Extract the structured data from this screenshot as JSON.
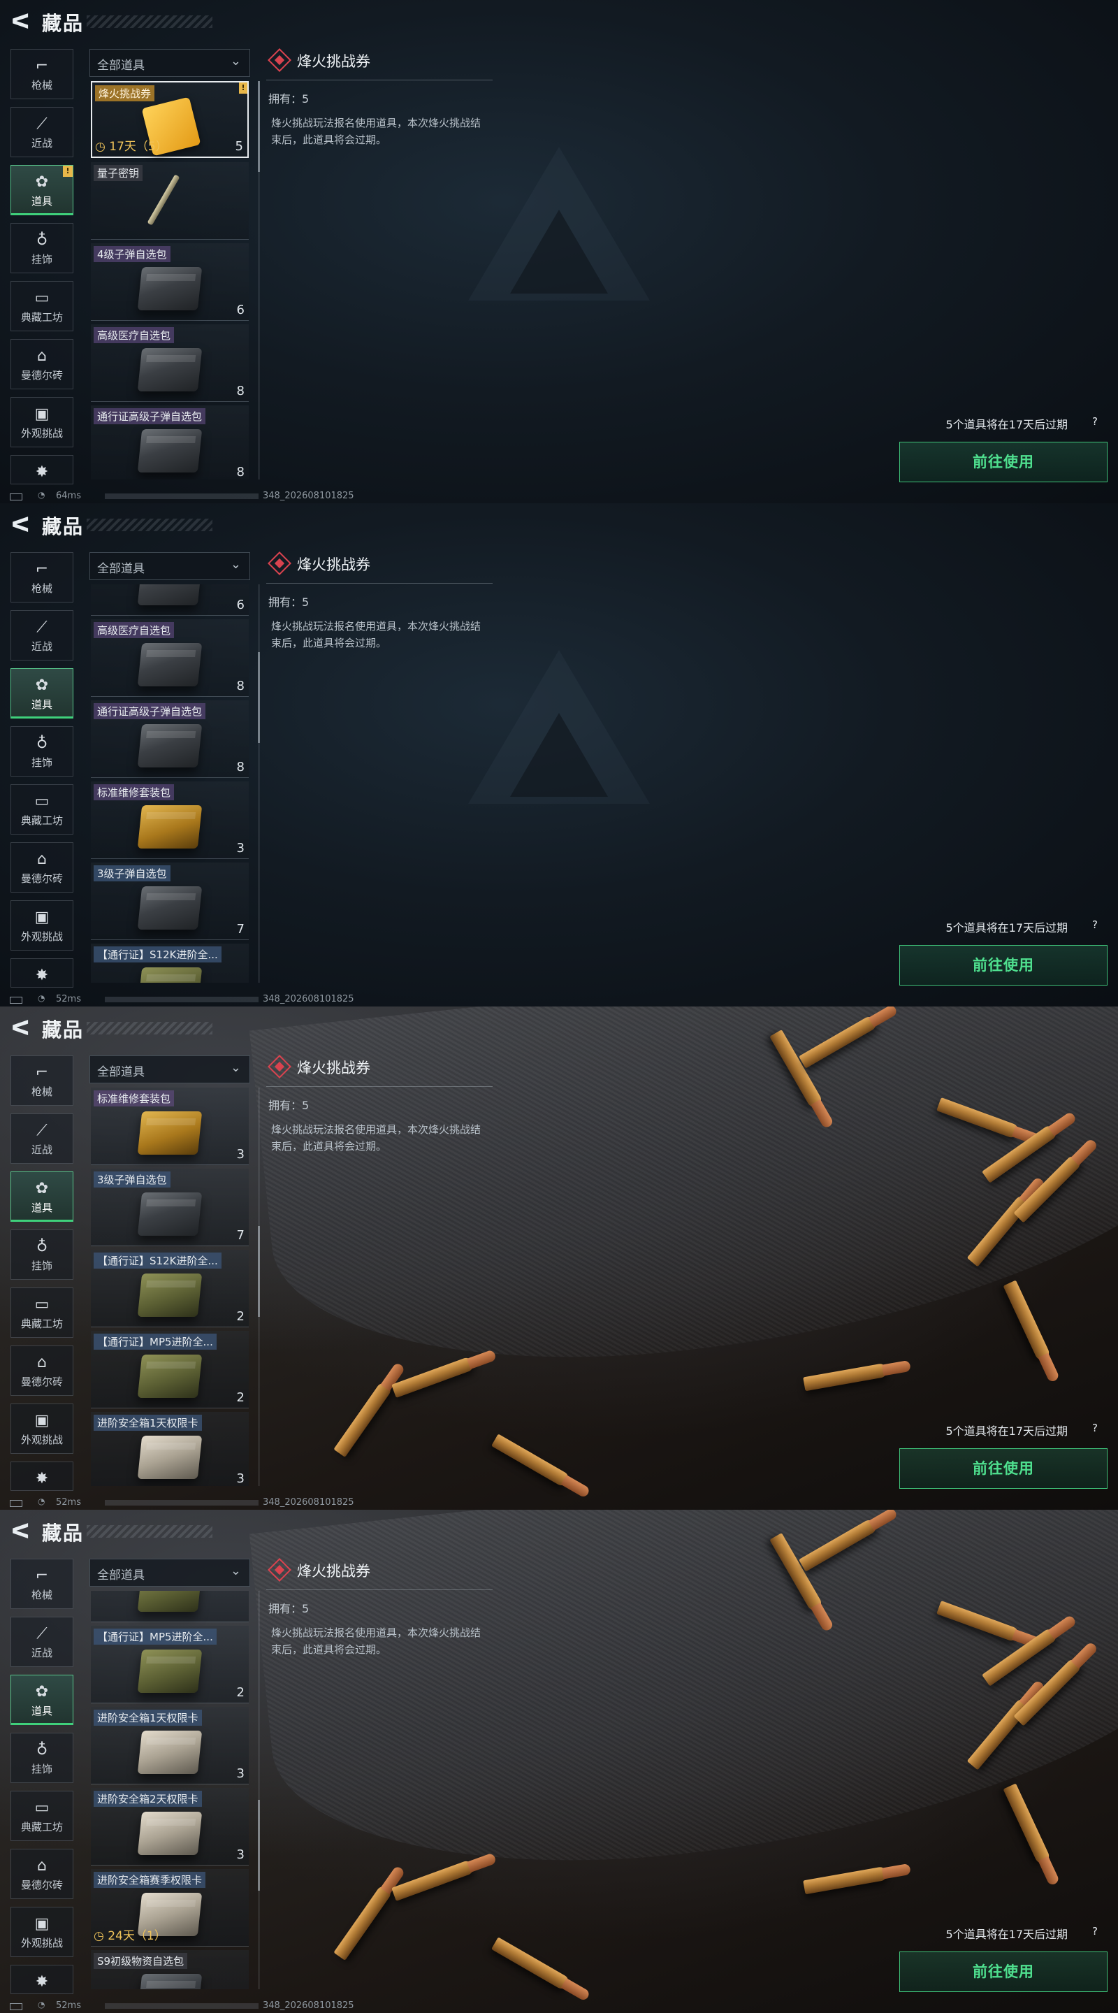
{
  "header": {
    "back_icon": "back-arrow-icon",
    "title": "藏品"
  },
  "categories": [
    {
      "icon": "gun-icon",
      "glyph": "⌐",
      "label": "枪械"
    },
    {
      "icon": "knife-icon",
      "glyph": "⟋",
      "label": "近战"
    },
    {
      "icon": "props-icon",
      "glyph": "✿",
      "label": "道具"
    },
    {
      "icon": "pendant-icon",
      "glyph": "♁",
      "label": "挂饰"
    },
    {
      "icon": "workshop-icon",
      "glyph": "▭",
      "label": "典藏工坊"
    },
    {
      "icon": "brick-icon",
      "glyph": "⌂",
      "label": "曼德尔砖"
    },
    {
      "icon": "appearance-icon",
      "glyph": "▣",
      "label": "外观挑战"
    },
    {
      "icon": "partial-icon",
      "glyph": "✸",
      "label": ""
    }
  ],
  "filter": {
    "value": "全部道具",
    "chevron": "chevron-down-icon"
  },
  "detail": {
    "title": "烽火挑战券",
    "owned": "拥有：5",
    "description": "烽火挑战玩法报名使用道具，本次烽火挑战结束后，此道具将会过期。",
    "expire_note": "5个道具将在17天后过期",
    "help": "?",
    "use_button": "前往使用"
  },
  "status": {
    "ping_a": "64ms",
    "ping_b": "52ms",
    "code": "348_202608101825"
  },
  "frames": [
    {
      "bg": "dark",
      "scroll_top": 0,
      "items": [
        {
          "name": "烽火挑战券",
          "tag": "gold",
          "count": "5",
          "timer": "17天（5）",
          "selected": true,
          "new": true,
          "thumb": "ticket"
        },
        {
          "name": "量子密钥",
          "tag": "dark",
          "count": "",
          "timer": "",
          "thumb": "key"
        },
        {
          "name": "4级子弹自选包",
          "tag": "purple",
          "count": "6",
          "timer": "",
          "thumb": "box"
        },
        {
          "name": "高级医疗自选包",
          "tag": "purple",
          "count": "8",
          "timer": "",
          "thumb": "box"
        },
        {
          "name": "通行证高级子弹自选包",
          "tag": "purple",
          "count": "8",
          "timer": "",
          "thumb": "box"
        }
      ]
    },
    {
      "bg": "dark",
      "scroll_top": 0.22,
      "items": [
        {
          "name": "",
          "tag": "none",
          "count": "6",
          "timer": "",
          "thumb": "box"
        },
        {
          "name": "高级医疗自选包",
          "tag": "purple",
          "count": "8",
          "timer": "",
          "thumb": "box"
        },
        {
          "name": "通行证高级子弹自选包",
          "tag": "purple",
          "count": "8",
          "timer": "",
          "thumb": "box"
        },
        {
          "name": "标准维修套装包",
          "tag": "purple",
          "count": "3",
          "timer": "",
          "thumb": "gold"
        },
        {
          "name": "3级子弹自选包",
          "tag": "blue",
          "count": "7",
          "timer": "",
          "thumb": "box"
        },
        {
          "name": "【通行证】S12K进阶全...",
          "tag": "blue",
          "count": "",
          "timer": "",
          "thumb": "olive"
        }
      ]
    },
    {
      "bg": "photo",
      "scroll_top": 0.45,
      "items": [
        {
          "name": "标准维修套装包",
          "tag": "purple",
          "count": "3",
          "timer": "",
          "thumb": "gold"
        },
        {
          "name": "3级子弹自选包",
          "tag": "blue",
          "count": "7",
          "timer": "",
          "thumb": "box"
        },
        {
          "name": "【通行证】S12K进阶全...",
          "tag": "blue",
          "count": "2",
          "timer": "",
          "thumb": "olive"
        },
        {
          "name": "【通行证】MP5进阶全...",
          "tag": "blue",
          "count": "2",
          "timer": "",
          "thumb": "olive"
        },
        {
          "name": "进阶安全箱1天权限卡",
          "tag": "blue",
          "count": "3",
          "timer": "",
          "thumb": "silver"
        }
      ]
    },
    {
      "bg": "photo",
      "scroll_top": 0.68,
      "items": [
        {
          "name": "",
          "tag": "none",
          "count": "",
          "timer": "",
          "thumb": "olive"
        },
        {
          "name": "【通行证】MP5进阶全...",
          "tag": "blue",
          "count": "2",
          "timer": "",
          "thumb": "olive"
        },
        {
          "name": "进阶安全箱1天权限卡",
          "tag": "blue",
          "count": "3",
          "timer": "",
          "thumb": "silver"
        },
        {
          "name": "进阶安全箱2天权限卡",
          "tag": "blue",
          "count": "3",
          "timer": "",
          "thumb": "silver"
        },
        {
          "name": "进阶安全箱赛季权限卡",
          "tag": "blue",
          "count": "",
          "timer": "24天（1）",
          "thumb": "silver"
        },
        {
          "name": "S9初级物资自选包",
          "tag": "dark",
          "count": "",
          "timer": "",
          "thumb": "box"
        }
      ]
    }
  ],
  "colors": {
    "accent_green": "#4fe08f",
    "gold_tag": "#b4822a",
    "selected_border": "#e8ecef",
    "warning_red": "#d9434f"
  }
}
